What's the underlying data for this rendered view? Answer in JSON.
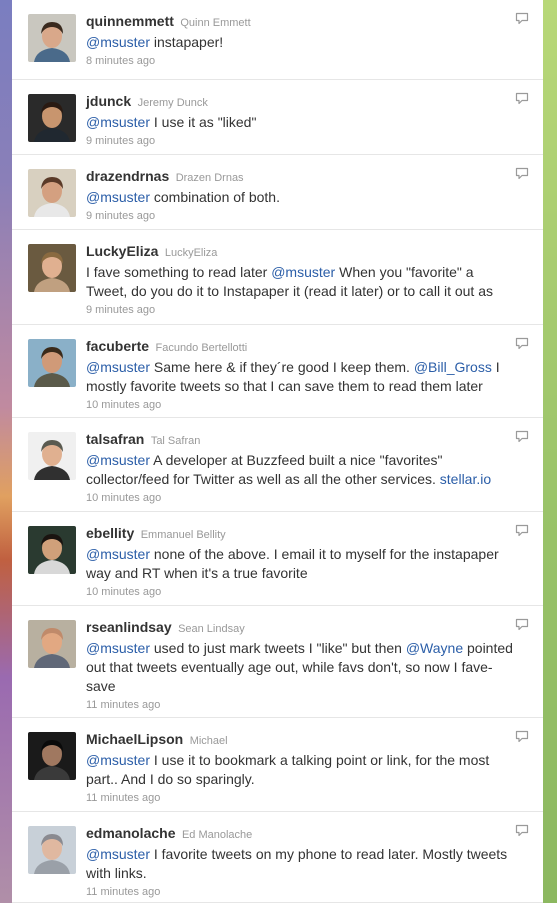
{
  "tweets": [
    {
      "screen_name": "quinnemmett",
      "full_name": "Quinn Emmett",
      "time": "8 minutes ago",
      "segments": [
        {
          "t": "@msuster",
          "m": true
        },
        {
          "t": " instapaper!",
          "m": false
        }
      ],
      "avatar": {
        "bg": "#c9c7bf",
        "skin": "#d9a88a",
        "hair": "#3a2a1e",
        "shirt": "#4a6a8a"
      },
      "reply": true
    },
    {
      "screen_name": "jdunck",
      "full_name": "Jeremy Dunck",
      "time": "9 minutes ago",
      "segments": [
        {
          "t": "@msuster",
          "m": true
        },
        {
          "t": " I use it as \"liked\"",
          "m": false
        }
      ],
      "avatar": {
        "bg": "#2a2a2a",
        "skin": "#c8956e",
        "hair": "#2a1a12",
        "shirt": "#202830"
      },
      "reply": true
    },
    {
      "screen_name": "drazendrnas",
      "full_name": "Drazen Drnas",
      "time": "9 minutes ago",
      "segments": [
        {
          "t": "@msuster",
          "m": true
        },
        {
          "t": " combination of both.",
          "m": false
        }
      ],
      "avatar": {
        "bg": "#d8d0c0",
        "skin": "#d4a080",
        "hair": "#5a3a28",
        "shirt": "#e8e8e8"
      },
      "reply": true
    },
    {
      "screen_name": "LuckyEliza",
      "full_name": "LuckyEliza",
      "time": "9 minutes ago",
      "segments": [
        {
          "t": "I fave something to read later ",
          "m": false
        },
        {
          "t": "@msuster",
          "m": true
        },
        {
          "t": " When you \"favorite\" a Tweet, do you do it to Instapaper it (read it later) or to call it out as",
          "m": false
        }
      ],
      "avatar": {
        "bg": "#6a5a40",
        "skin": "#e0b090",
        "hair": "#8a6a40",
        "shirt": "#c0a080"
      },
      "reply": false
    },
    {
      "screen_name": "facuberte",
      "full_name": "Facundo Bertellotti",
      "time": "10 minutes ago",
      "segments": [
        {
          "t": "@msuster",
          "m": true
        },
        {
          "t": " Same here & if they´re good I keep them. ",
          "m": false
        },
        {
          "t": "@Bill_Gross",
          "m": true
        },
        {
          "t": " I mostly favorite tweets so that I can save them to read them later",
          "m": false
        }
      ],
      "avatar": {
        "bg": "#8ab0c8",
        "skin": "#d09a78",
        "hair": "#3a2a1a",
        "shirt": "#5a5a4a"
      },
      "reply": true
    },
    {
      "screen_name": "talsafran",
      "full_name": "Tal Safran",
      "time": "10 minutes ago",
      "segments": [
        {
          "t": "@msuster",
          "m": true
        },
        {
          "t": " A developer at Buzzfeed built a nice \"favorites\" collector/feed for Twitter as well as all the other services. ",
          "m": false
        },
        {
          "t": "stellar.io",
          "m": true
        }
      ],
      "avatar": {
        "bg": "#f0f0f0",
        "skin": "#e0b090",
        "hair": "#5a5a50",
        "shirt": "#303030"
      },
      "reply": true
    },
    {
      "screen_name": "ebellity",
      "full_name": "Emmanuel Bellity",
      "time": "10 minutes ago",
      "segments": [
        {
          "t": "@msuster",
          "m": true
        },
        {
          "t": " none of the above. I email it to myself for the instapaper way and RT when it's a true favorite",
          "m": false
        }
      ],
      "avatar": {
        "bg": "#2a3a30",
        "skin": "#d0a07a",
        "hair": "#1a1410",
        "shirt": "#d8d8d8"
      },
      "reply": true
    },
    {
      "screen_name": "rseanlindsay",
      "full_name": "Sean Lindsay",
      "time": "11 minutes ago",
      "segments": [
        {
          "t": "@msuster",
          "m": true
        },
        {
          "t": " used to just mark tweets I \"like\" but then ",
          "m": false
        },
        {
          "t": "@Wayne",
          "m": true
        },
        {
          "t": " pointed out that tweets eventually age out, while favs don't, so now I fave-save",
          "m": false
        }
      ],
      "avatar": {
        "bg": "#b8b0a0",
        "skin": "#e2a882",
        "hair": "#c08a6a",
        "shirt": "#606878"
      },
      "reply": true
    },
    {
      "screen_name": "MichaelLipson",
      "full_name": "Michael",
      "time": "11 minutes ago",
      "segments": [
        {
          "t": "@msuster",
          "m": true
        },
        {
          "t": " I use it to bookmark a talking point or link, for the most part.. And I do so sparingly.",
          "m": false
        }
      ],
      "avatar": {
        "bg": "#1a1a1a",
        "skin": "#a07860",
        "hair": "#0a0a0a",
        "shirt": "#3a3a3a"
      },
      "reply": true
    },
    {
      "screen_name": "edmanolache",
      "full_name": "Ed Manolache",
      "time": "11 minutes ago",
      "segments": [
        {
          "t": "@msuster",
          "m": true
        },
        {
          "t": " I favorite tweets on my phone to read later. Mostly tweets with links.",
          "m": false
        }
      ],
      "avatar": {
        "bg": "#c8d0d8",
        "skin": "#e0b8a0",
        "hair": "#8a8a90",
        "shirt": "#9aa0a8"
      },
      "reply": true
    }
  ]
}
